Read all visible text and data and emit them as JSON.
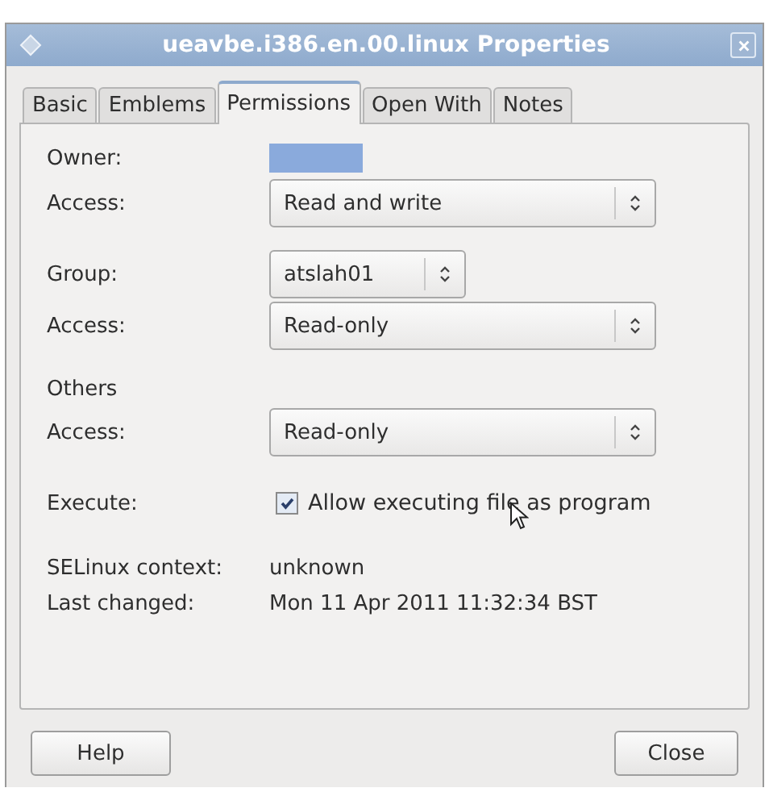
{
  "window": {
    "title": "ueavbe.i386.en.00.linux Properties"
  },
  "tabs": [
    {
      "label": "Basic",
      "selected": false
    },
    {
      "label": "Emblems",
      "selected": false
    },
    {
      "label": "Permissions",
      "selected": true
    },
    {
      "label": "Open With",
      "selected": false
    },
    {
      "label": "Notes",
      "selected": false
    }
  ],
  "sections": [
    [
      {
        "kind": "owner",
        "label": "Owner:"
      },
      {
        "kind": "dropdown",
        "label": "Access:",
        "value": "Read and write"
      }
    ],
    [
      {
        "kind": "small_dropdown",
        "label": "Group:",
        "value": "atslah01"
      },
      {
        "kind": "dropdown",
        "label": "Access:",
        "value": "Read-only"
      }
    ],
    [
      {
        "kind": "heading",
        "label": "Others"
      },
      {
        "kind": "dropdown",
        "label": "Access:",
        "value": "Read-only"
      }
    ],
    [
      {
        "kind": "checkbox",
        "label": "Execute:",
        "value": "Allow executing file as program",
        "checked": true
      }
    ],
    [
      {
        "kind": "info",
        "label": "SELinux context:",
        "value": "unknown"
      },
      {
        "kind": "info",
        "label": "Last changed:",
        "value": "Mon 11 Apr 2011 11:32:34 BST"
      }
    ]
  ],
  "buttons": [
    "Help",
    "Close"
  ]
}
